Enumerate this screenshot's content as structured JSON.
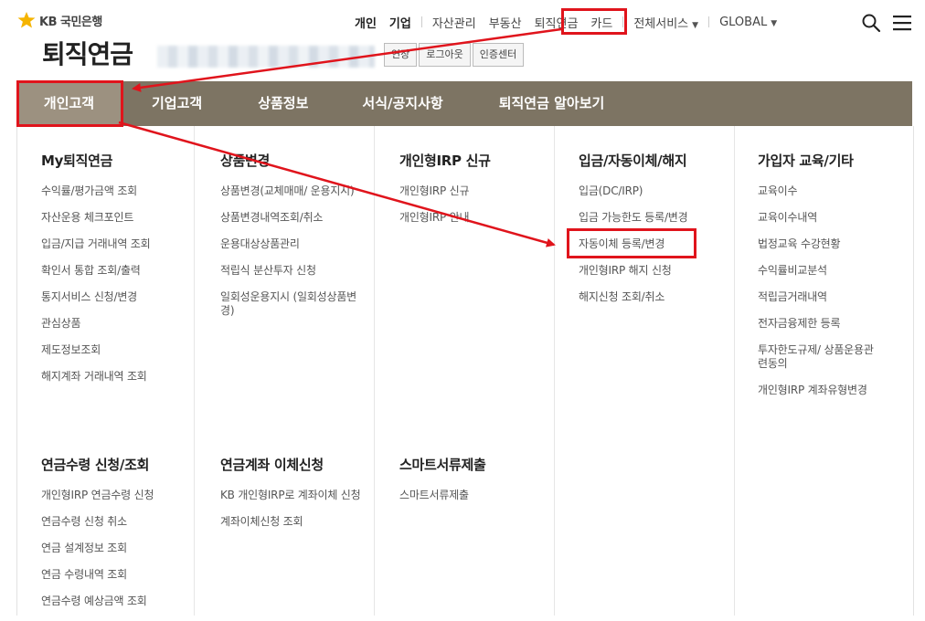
{
  "header": {
    "logo_text": "KB 국민은행",
    "page_title": "퇴직연금",
    "auth_buttons": [
      "연장",
      "로그아웃",
      "인증센터"
    ],
    "util_nav": {
      "personal": "개인",
      "corporate": "기업",
      "asset": "자산관리",
      "realestate": "부동산",
      "pension": "퇴직연금",
      "card": "카드",
      "all_services": "전체서비스",
      "global": "GLOBAL"
    }
  },
  "gnb": [
    "개인고객",
    "기업고객",
    "상품정보",
    "서식/공지사항",
    "퇴직연금 알아보기"
  ],
  "menu": {
    "col1": {
      "title": "My퇴직연금",
      "links": [
        "수익률/평가금액 조회",
        "자산운용 체크포인트",
        "입금/지급 거래내역 조회",
        "확인서 통합 조회/출력",
        "통지서비스 신청/변경",
        "관심상품",
        "제도정보조회",
        "해지계좌 거래내역 조회"
      ]
    },
    "col2": {
      "title": "상품변경",
      "links": [
        "상품변경(교체매매/ 운용지시)",
        "상품변경내역조회/취소",
        "운용대상상품관리",
        "적립식 분산투자 신청",
        "일회성운용지시 (일회성상품변경)"
      ]
    },
    "col3": {
      "title": "개인형IRP 신규",
      "links": [
        "개인형IRP 신규",
        "개인형IRP 안내"
      ]
    },
    "col4": {
      "title": "입금/자동이체/해지",
      "links": [
        "입금(DC/IRP)",
        "입금 가능한도 등록/변경",
        "자동이체 등록/변경",
        "개인형IRP 해지 신청",
        "해지신청 조회/취소"
      ]
    },
    "col5": {
      "title": "가입자 교육/기타",
      "links": [
        "교육이수",
        "교육이수내역",
        "법정교육 수강현황",
        "수익률비교분석",
        "적립금거래내역",
        "전자금융제한 등록",
        "투자한도규제/ 상품운용관련동의",
        "개인형IRP 계좌유형변경"
      ]
    },
    "col6": {
      "title": "연금수령 신청/조회",
      "links": [
        "개인형IRP 연금수령 신청",
        "연금수령 신청 취소",
        "연금 설계정보 조회",
        "연금 수령내역 조회",
        "연금수령 예상금액 조회"
      ]
    },
    "col7": {
      "title": "연금계좌 이체신청",
      "links": [
        "KB 개인형IRP로 계좌이체 신청",
        "계좌이체신청 조회"
      ]
    },
    "col8": {
      "title": "스마트서류제출",
      "links": [
        "스마트서류제출"
      ]
    }
  },
  "colors": {
    "gnb_bg": "#7d7463",
    "gnb_active": "#9c9180",
    "highlight": "#e0141c",
    "logo_star": "#f5b400"
  }
}
